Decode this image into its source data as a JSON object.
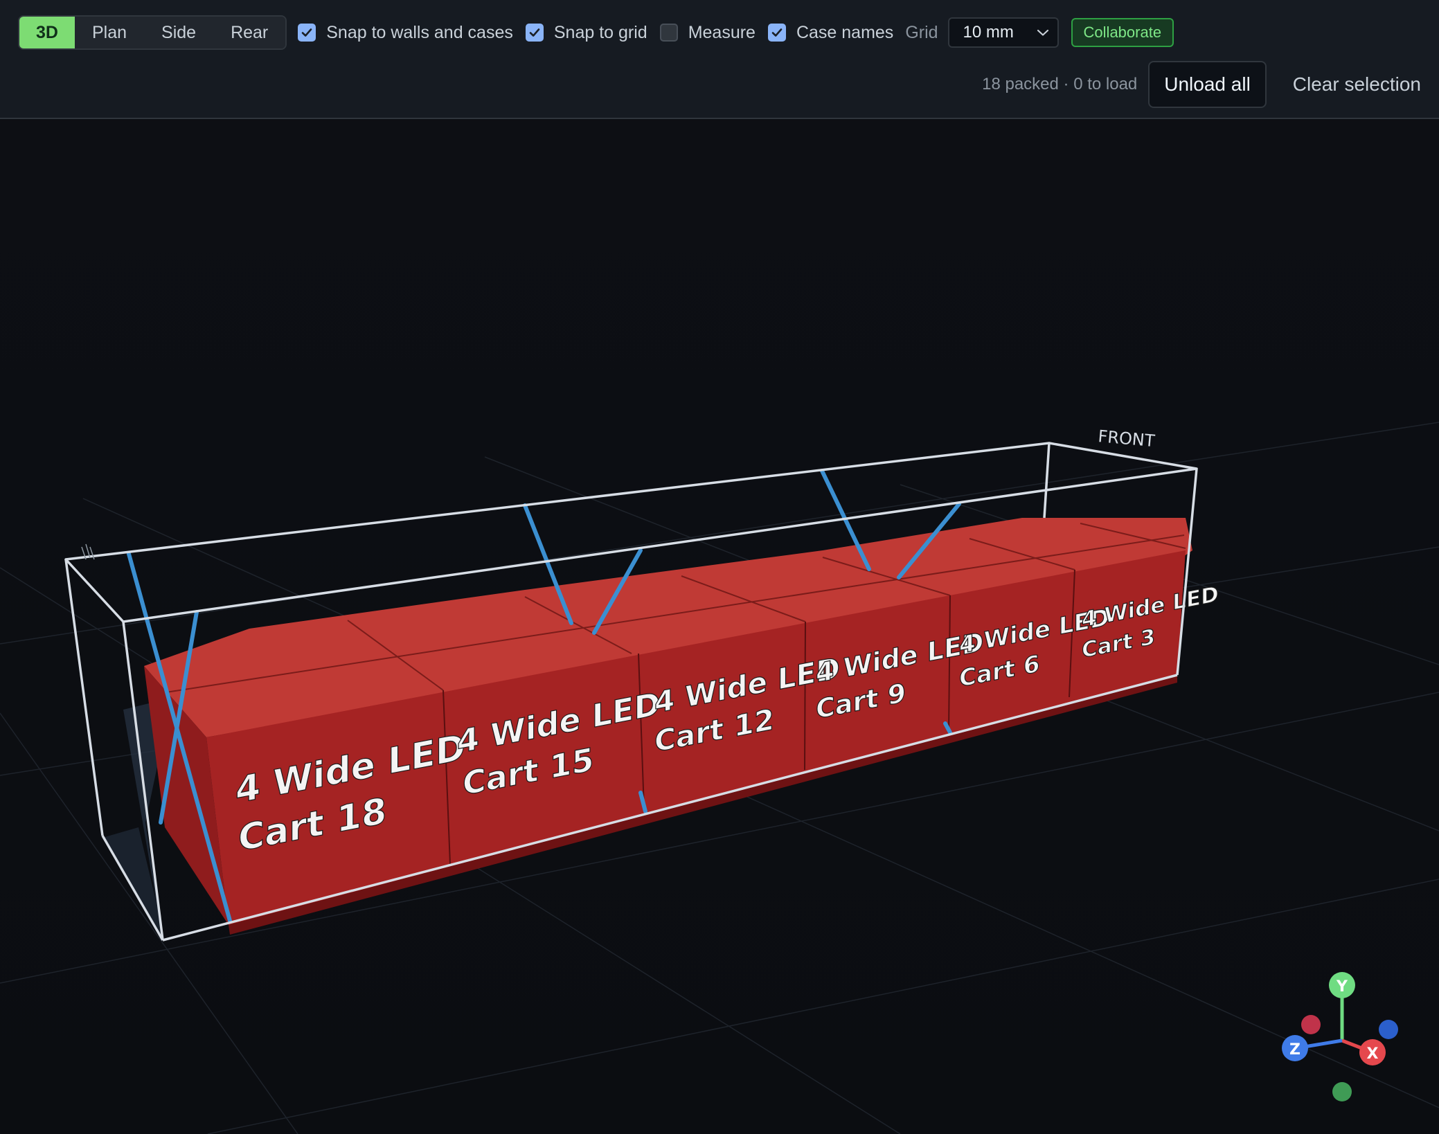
{
  "toolbar": {
    "views": [
      "3D",
      "Plan",
      "Side",
      "Rear"
    ],
    "active_view": "3D",
    "options": {
      "snap_walls": {
        "label": "Snap to walls and cases",
        "checked": true
      },
      "snap_grid": {
        "label": "Snap to grid",
        "checked": true
      },
      "measure": {
        "label": "Measure",
        "checked": false
      },
      "case_names": {
        "label": "Case names",
        "checked": true
      }
    },
    "grid_label": "Grid",
    "grid_value": "10 mm",
    "collaborate_label": "Collaborate",
    "status": "18 packed · 0 to load",
    "unload_label": "Unload all",
    "clear_label": "Clear selection"
  },
  "scene": {
    "front_label": "FRONT",
    "case_line1": "4 Wide LED",
    "cases": [
      "Cart 18",
      "Cart 15",
      "Cart 12",
      "Cart 9",
      "Cart 6",
      "Cart 3"
    ],
    "axes": {
      "x": "X",
      "y": "Y",
      "z": "Z"
    },
    "colors": {
      "case_face": "#a52323",
      "case_top": "#c03a35",
      "strap": "#3b8fd1",
      "axis_x": "#e5484d",
      "axis_y": "#6fdc82",
      "axis_z": "#3f7be8"
    }
  }
}
